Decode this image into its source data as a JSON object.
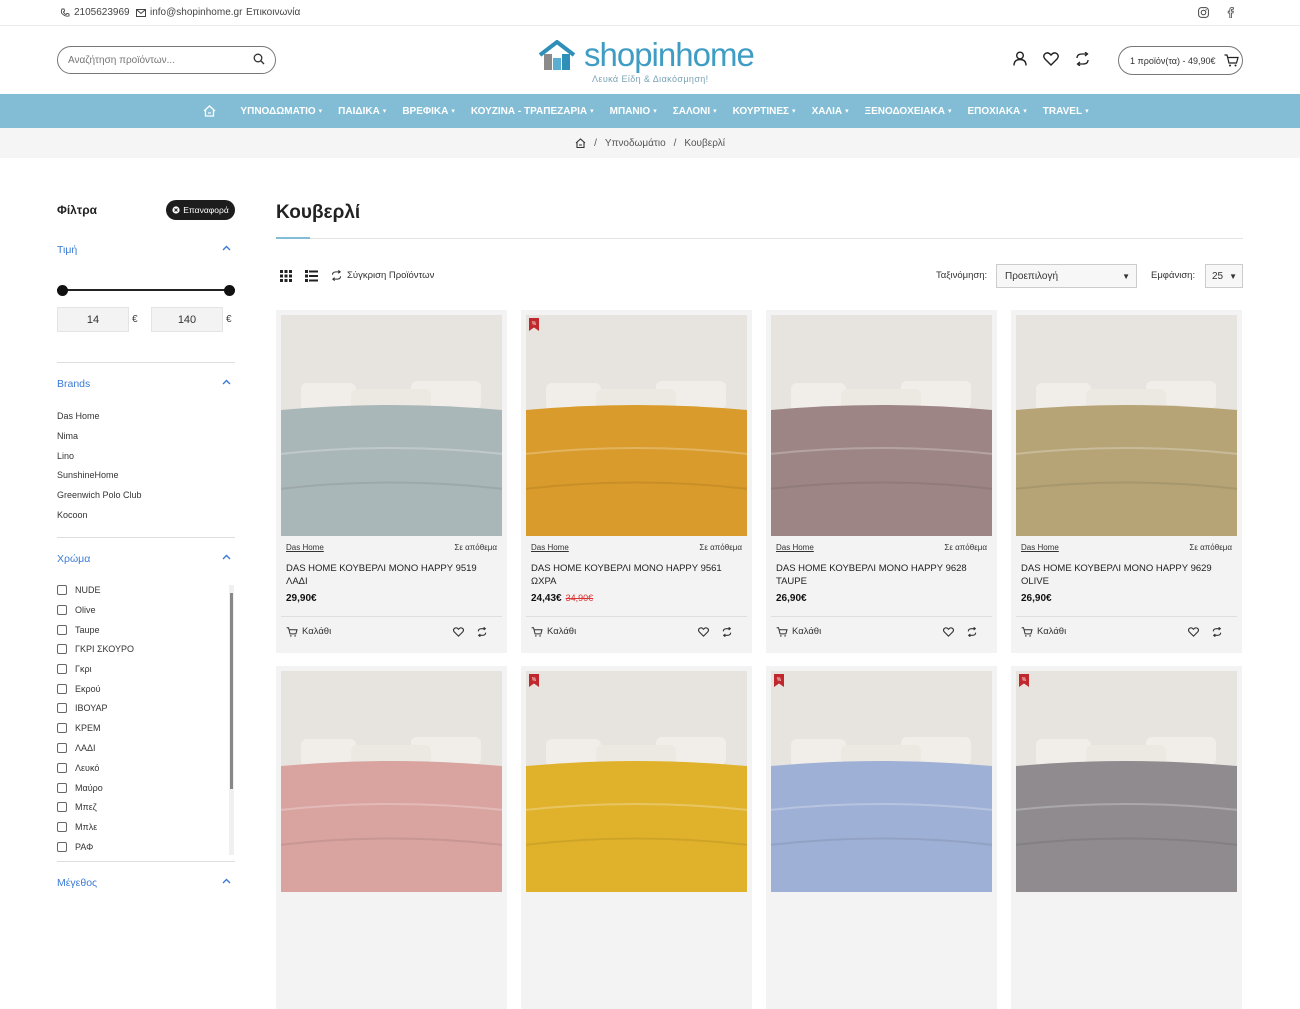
{
  "topbar": {
    "phone": "2105623969",
    "email": "info@shopinhome.gr",
    "contact": "Επικοινωνία"
  },
  "header": {
    "search_placeholder": "Αναζήτηση προϊόντων...",
    "logo_text_a": "shopin",
    "logo_text_b": "home",
    "logo_tagline": "Λευκά Είδη & Διακόσμηση!",
    "cart_label": "1 προϊόν(τα) - 49,90€"
  },
  "nav": {
    "items": [
      {
        "label": "ΥΠΝΟΔΩΜΑΤΙΟ"
      },
      {
        "label": "ΠΑΙΔΙΚΑ"
      },
      {
        "label": "ΒΡΕΦΙΚΑ"
      },
      {
        "label": "ΚΟΥΖΙΝΑ - ΤΡΑΠΕΖΑΡΙΑ"
      },
      {
        "label": "ΜΠΑΝΙΟ"
      },
      {
        "label": "ΣΑΛΟΝΙ"
      },
      {
        "label": "ΚΟΥΡΤΙΝΕΣ"
      },
      {
        "label": "ΧΑΛΙΑ"
      },
      {
        "label": "ΞΕΝΟΔΟΧΕΙΑΚΑ"
      },
      {
        "label": "ΕΠΟΧΙΑΚΑ"
      },
      {
        "label": "TRAVEL"
      }
    ]
  },
  "breadcrumb": {
    "sep": "/",
    "level1": "Υπνοδωμάτιο",
    "level2": "Κουβερλί"
  },
  "filters": {
    "title": "Φίλτρα",
    "reset": "Επαναφορά",
    "price": {
      "title": "Τιμή",
      "min": "14",
      "max": "140",
      "currency": "€"
    },
    "brands": {
      "title": "Brands",
      "items": [
        "Das Home",
        "Nima",
        "Lino",
        "SunshineHome",
        "Greenwich Polo Club",
        "Kocoon"
      ]
    },
    "color": {
      "title": "Χρώμα",
      "items": [
        "NUDE",
        "Olive",
        "Taupe",
        "ΓΚΡΙ ΣΚΟΥΡΟ",
        "Γκρι",
        "Εκρού",
        "ΙΒΟΥΑΡ",
        "ΚΡΕΜ",
        "ΛΑΔΙ",
        "Λευκό",
        "Μαύρο",
        "Μπεζ",
        "Μπλε",
        "ΡΑΦ"
      ]
    },
    "size": {
      "title": "Μέγεθος"
    }
  },
  "main": {
    "title": "Κουβερλί",
    "compare_label": "Σύγκριση Προϊόντων",
    "sort_label": "Ταξινόμηση:",
    "sort_value": "Προεπιλογή",
    "show_label": "Εμφάνιση:",
    "show_value": "25"
  },
  "products": [
    {
      "brand": "Das Home",
      "stock": "Σε απόθεμα",
      "name": "DAS HOME ΚΟΥΒΕΡΛΙ ΜΟΝΟ HAPPY 9519 ΛΑΔΙ",
      "price": "29,90€",
      "old_price": "",
      "sale": false,
      "color": "#aab7b8",
      "cart": "Καλάθι"
    },
    {
      "brand": "Das Home",
      "stock": "Σε απόθεμα",
      "name": "DAS HOME ΚΟΥΒΕΡΛΙ ΜΟΝΟ HAPPY 9561 ΩΧΡΑ",
      "price": "24,43€",
      "old_price": "34,90€",
      "sale": true,
      "color": "#d99b2b",
      "cart": "Καλάθι"
    },
    {
      "brand": "Das Home",
      "stock": "Σε απόθεμα",
      "name": "DAS HOME ΚΟΥΒΕΡΛΙ ΜΟΝΟ HAPPY 9628 TAUPE",
      "price": "26,90€",
      "old_price": "",
      "sale": false,
      "color": "#9d8585",
      "cart": "Καλάθι"
    },
    {
      "brand": "Das Home",
      "stock": "Σε απόθεμα",
      "name": "DAS HOME ΚΟΥΒΕΡΛΙ ΜΟΝΟ HAPPY 9629 OLIVE",
      "price": "26,90€",
      "old_price": "",
      "sale": false,
      "color": "#b6a477",
      "cart": "Καλάθι"
    },
    {
      "brand": "",
      "stock": "",
      "name": "",
      "price": "",
      "old_price": "",
      "sale": false,
      "color": "#d9a3a0",
      "cart": ""
    },
    {
      "brand": "",
      "stock": "",
      "name": "",
      "price": "",
      "old_price": "",
      "sale": true,
      "color": "#e0b22c",
      "cart": ""
    },
    {
      "brand": "",
      "stock": "",
      "name": "",
      "price": "",
      "old_price": "",
      "sale": true,
      "color": "#9fb0d6",
      "cart": ""
    },
    {
      "brand": "",
      "stock": "",
      "name": "",
      "price": "",
      "old_price": "",
      "sale": true,
      "color": "#8f8b8f",
      "cart": ""
    }
  ]
}
